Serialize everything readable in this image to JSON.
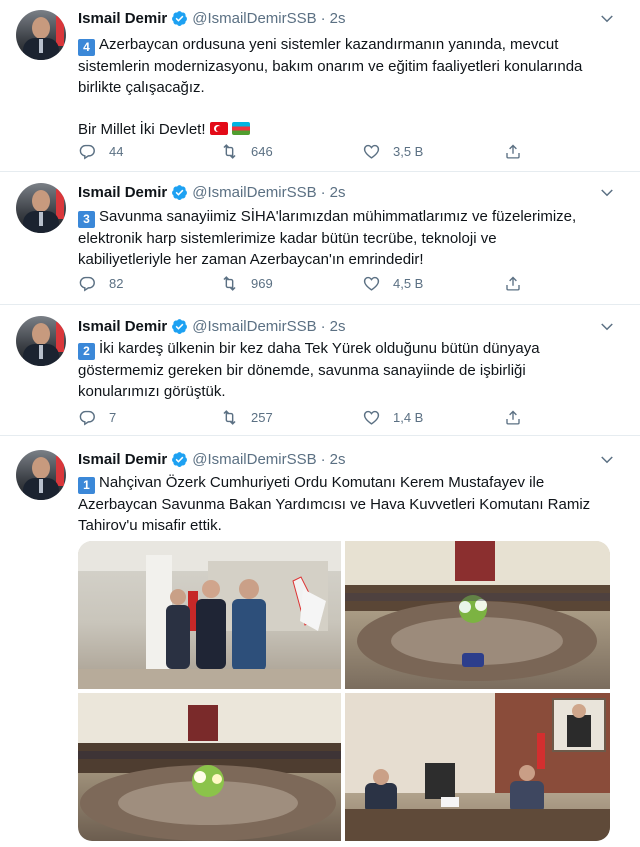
{
  "tweets": [
    {
      "author": {
        "name": "Ismail Demir",
        "handle": "@IsmailDemirSSB",
        "dot": "·",
        "time": "2s"
      },
      "badge": "4",
      "text_lines": [
        "Azerbaycan ordusuna yeni sistemler kazandırmanın yanında, mevcut",
        "sistemlerin modernizasyonu, bakım onarım ve eğitim faaliyetleri konularında",
        "birlikte çalışacağız."
      ],
      "closing": "Bir Millet İki Devlet!",
      "flags": [
        "turkey-flag",
        "azerbaijan-flag"
      ],
      "stats": {
        "replies": "44",
        "retweets": "646",
        "likes": "3,5 B"
      }
    },
    {
      "author": {
        "name": "Ismail Demir",
        "handle": "@IsmailDemirSSB",
        "dot": "·",
        "time": "2s"
      },
      "badge": "3",
      "text_lines": [
        "Savunma sanayiimiz SİHA'larımızdan mühimmatlarımız ve füzelerimize,",
        "elektronik harp sistemlerimize kadar bütün tecrübe, teknoloji ve",
        "kabiliyetleriyle her zaman Azerbaycan'ın emrindedir!"
      ],
      "stats": {
        "replies": "82",
        "retweets": "969",
        "likes": "4,5 B"
      }
    },
    {
      "author": {
        "name": "Ismail Demir",
        "handle": "@IsmailDemirSSB",
        "dot": "·",
        "time": "2s"
      },
      "badge": "2",
      "text_lines": [
        "İki kardeş ülkenin bir kez daha Tek Yürek olduğunu bütün dünyaya",
        "göstermemiz gereken bir dönemde, savunma sanayiinde de işbirliği",
        "konularımızı görüştük."
      ],
      "stats": {
        "replies": "7",
        "retweets": "257",
        "likes": "1,4 B"
      }
    },
    {
      "author": {
        "name": "Ismail Demir",
        "handle": "@IsmailDemirSSB",
        "dot": "·",
        "time": "2s"
      },
      "badge": "1",
      "text_lines": [
        "Nahçivan Özerk Cumhuriyeti Ordu Komutanı Kerem Mustafayev ile",
        "Azerbaycan Savunma Bakan Yardımcısı ve Hava Kuvvetleri Komutanı Ramiz",
        "Tahirov'u misafir ettik."
      ],
      "media": [
        "meeting-photo-group",
        "meeting-photo-table",
        "meeting-photo-room",
        "meeting-photo-officials"
      ]
    }
  ],
  "icons": {
    "verified": "verified-badge-icon",
    "reply": "reply-icon",
    "retweet": "retweet-icon",
    "like": "heart-icon",
    "share": "share-icon",
    "more": "chevron-down-icon"
  },
  "colors": {
    "accent": "#1da1f2",
    "muted": "#5b7083",
    "divider": "#e6ecf0",
    "badge": "#3b88d8"
  }
}
